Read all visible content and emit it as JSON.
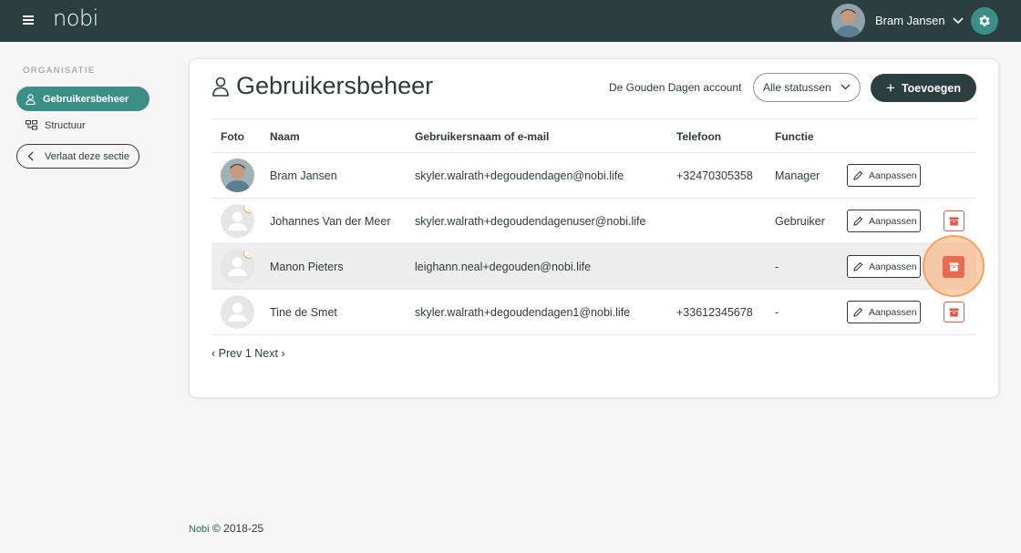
{
  "header": {
    "logo": "nobi",
    "user_name": "Bram Jansen",
    "colors": {
      "bar": "#2b3f40",
      "accent": "#3b8f88"
    }
  },
  "sidebar": {
    "heading": "ORGANISATIE",
    "items": [
      {
        "label": "Gebruikersbeheer",
        "icon": "user-icon",
        "active": true
      },
      {
        "label": "Structuur",
        "icon": "structure-icon",
        "active": false
      }
    ],
    "leave_label": "Verlaat deze sectie"
  },
  "main": {
    "title": "Gebruikersbeheer",
    "account_label": "De Gouden Dagen account",
    "status_filter": "Alle statussen",
    "add_label": "Toevoegen",
    "columns": [
      "Foto",
      "Naam",
      "Gebruikersnaam of e-mail",
      "Telefoon",
      "Functie"
    ],
    "rows": [
      {
        "name": "Bram Jansen",
        "email": "skyler.walrath+degoudendagen@nobi.life",
        "phone": "+32470305358",
        "role": "Manager",
        "edit": "Aanpassen",
        "has_photo": true,
        "warning": false,
        "deletable": false
      },
      {
        "name": "Johannes Van der Meer",
        "email": "skyler.walrath+degoudendagenuser@nobi.life",
        "phone": "",
        "role": "Gebruiker",
        "edit": "Aanpassen",
        "has_photo": false,
        "warning": true,
        "deletable": true
      },
      {
        "name": "Manon Pieters",
        "email": "leighann.neal+degouden@nobi.life",
        "phone": "",
        "role": "-",
        "edit": "Aanpassen",
        "has_photo": false,
        "warning": true,
        "deletable": true,
        "highlighted": true
      },
      {
        "name": "Tine de Smet",
        "email": "skyler.walrath+degoudendagen1@nobi.life",
        "phone": "+33612345678",
        "role": "-",
        "edit": "Aanpassen",
        "has_photo": false,
        "warning": false,
        "deletable": true
      }
    ],
    "pager": {
      "prev": "‹ Prev",
      "page": "1",
      "next": "Next ›"
    }
  },
  "footer": {
    "brand": "Nobi",
    "text": "© 2018-25"
  }
}
